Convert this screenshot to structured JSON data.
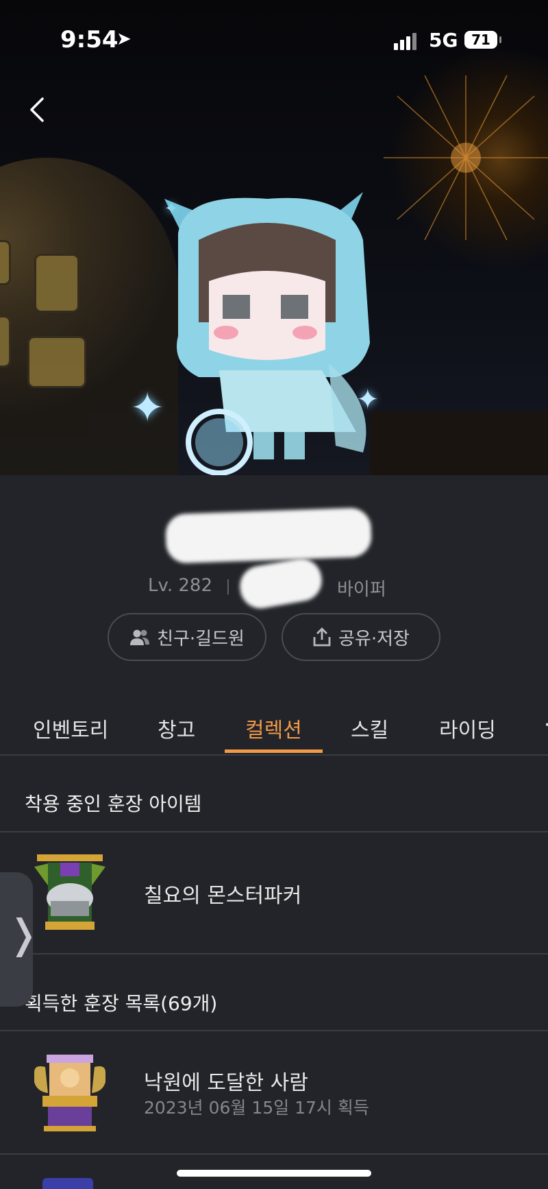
{
  "status_bar": {
    "time": "9:54",
    "network": "5G",
    "battery": "71"
  },
  "profile": {
    "level": "Lv. 282",
    "job": "바이퍼",
    "friend_button": "친구·길드원",
    "share_button": "공유·저장"
  },
  "tabs": [
    {
      "label": "인벤토리",
      "active": false
    },
    {
      "label": "창고",
      "active": false
    },
    {
      "label": "컬렉션",
      "active": true
    },
    {
      "label": "스킬",
      "active": false
    },
    {
      "label": "라이딩",
      "active": false
    }
  ],
  "equipped": {
    "title": "착용 중인 훈장 아이템",
    "item_name": "칠요의 몬스터파커"
  },
  "acquired": {
    "title": "획득한 훈장 목록(69개)",
    "items": [
      {
        "name": "낙원에 도달한 사람",
        "date": "2023년 06월 15일 17시 획득"
      }
    ]
  },
  "colors": {
    "accent": "#f2994a",
    "background": "#222429"
  }
}
